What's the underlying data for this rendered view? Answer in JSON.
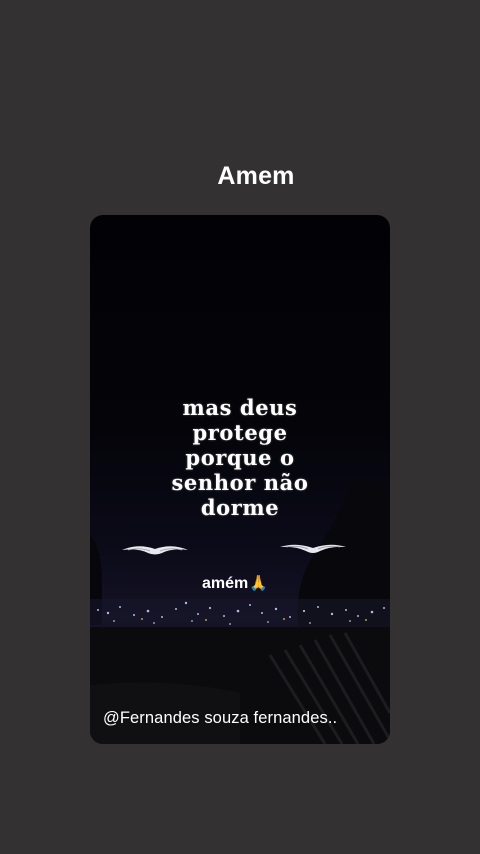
{
  "page": {
    "title": "Amem",
    "background_color": "#333132"
  },
  "story": {
    "quote_lines": [
      "mas deus",
      "protege",
      "porque o",
      "senhor não",
      "dorme"
    ],
    "caption": "amém",
    "caption_icon": "praying-hands-icon",
    "caption_icon_glyph": "🙏",
    "handle": "@Fernandes  souza fernandes.."
  }
}
